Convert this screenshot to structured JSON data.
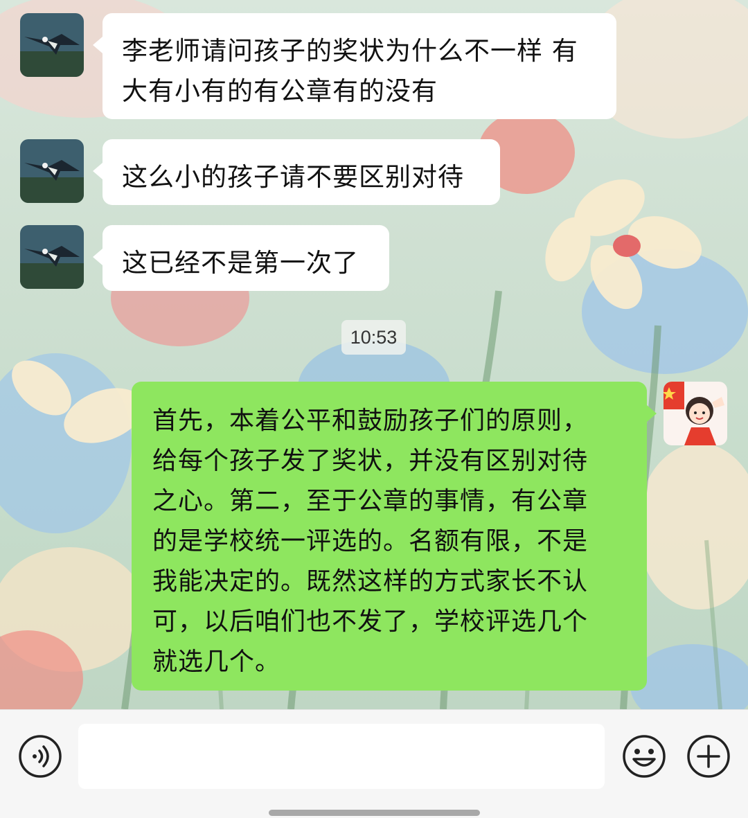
{
  "chat": {
    "messages": [
      {
        "sender": "other",
        "avatar": "eagle-avatar",
        "text": "李老师请问孩子的奖状为什么不一样 有\n大有小有的有公章有的没有"
      },
      {
        "sender": "other",
        "avatar": "eagle-avatar",
        "text": "这么小的孩子请不要区别对待"
      },
      {
        "sender": "other",
        "avatar": "eagle-avatar",
        "text": "这已经不是第一次了"
      },
      {
        "sender": "self",
        "avatar": "girl-salute-avatar",
        "text": "首先，本着公平和鼓励孩子们的原则，\n给每个孩子发了奖状，并没有区别对待\n之心。第二，至于公章的事情，有公章\n的是学校统一评选的。名额有限，不是\n我能决定的。既然这样的方式家长不认\n可，以后咱们也不发了，学校评选几个\n就选几个。"
      }
    ],
    "timestamp": "10:53"
  },
  "input_bar": {
    "voice_icon": "voice-icon",
    "emoji_icon": "emoji-icon",
    "plus_icon": "plus-icon",
    "input_value": ""
  },
  "colors": {
    "incoming_bubble": "#ffffff",
    "outgoing_bubble": "#8ee65f",
    "input_bar_bg": "#f6f6f6"
  }
}
